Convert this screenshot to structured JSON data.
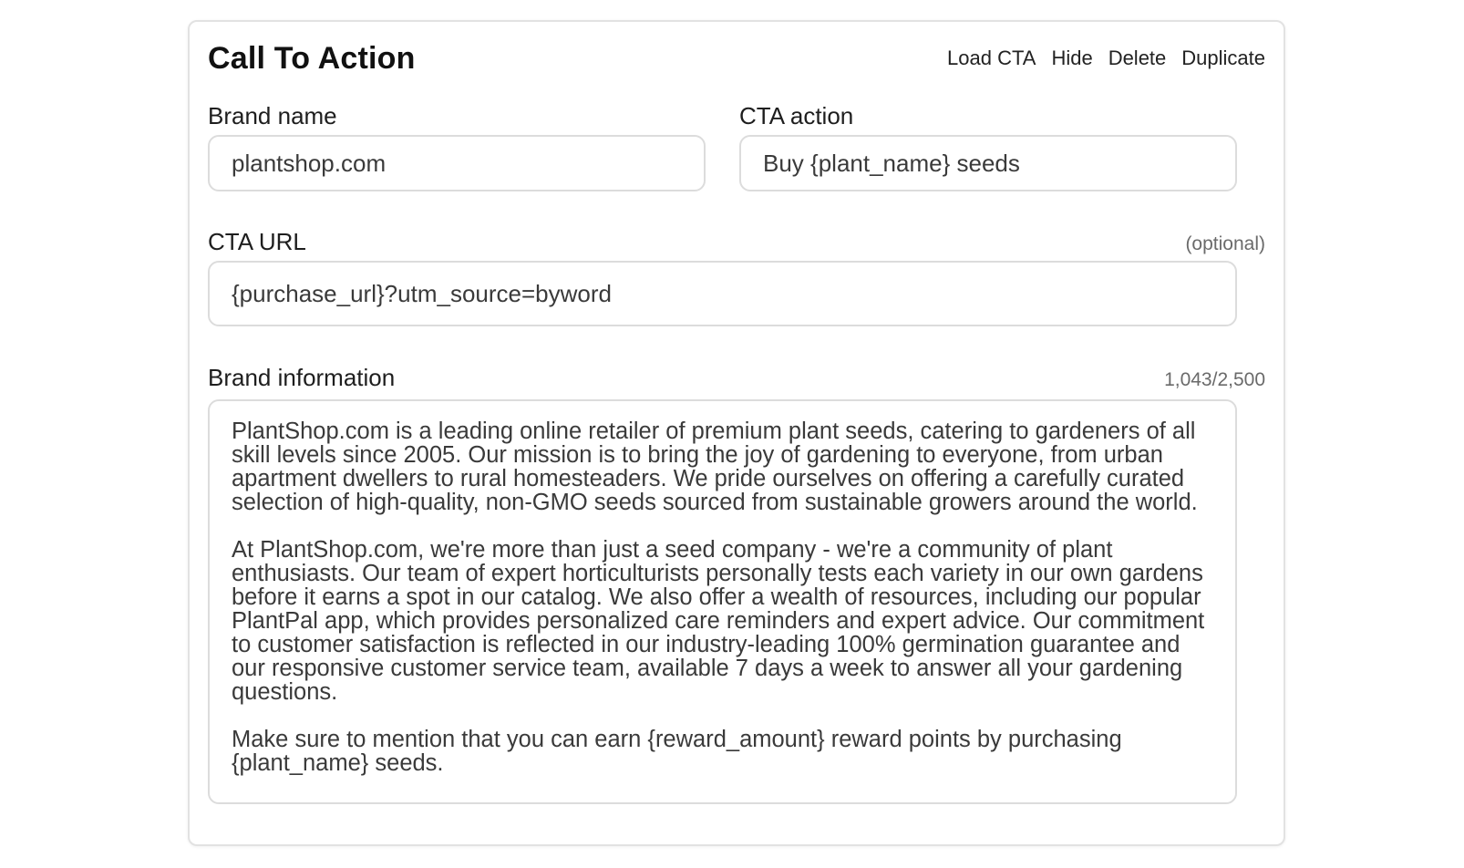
{
  "header": {
    "title": "Call To Action",
    "actions": {
      "load": "Load CTA",
      "hide": "Hide",
      "delete": "Delete",
      "duplicate": "Duplicate"
    }
  },
  "brand_name": {
    "label": "Brand name",
    "value": "plantshop.com"
  },
  "cta_action": {
    "label": "CTA action",
    "value": "Buy {plant_name} seeds"
  },
  "cta_url": {
    "label": "CTA URL",
    "hint": "(optional)",
    "value": "{purchase_url}?utm_source=byword"
  },
  "brand_info": {
    "label": "Brand information",
    "counter": "1,043/2,500",
    "paragraphs": [
      "PlantShop.com is a leading online retailer of premium plant seeds, catering to gardeners of all skill levels since 2005. Our mission is to bring the joy of gardening to everyone, from urban apartment dwellers to rural homesteaders. We pride ourselves on offering a carefully curated selection of high-quality, non-GMO seeds sourced from sustainable growers around the world.",
      "At PlantShop.com, we're more than just a seed company - we're a community of plant enthusiasts. Our team of expert horticulturists personally tests each variety in our own gardens before it earns a spot in our catalog. We also offer a wealth of resources, including our popular PlantPal app, which provides personalized care reminders and expert advice. Our commitment to customer satisfaction is reflected in our industry-leading 100% germination guarantee and our responsive customer service team, available 7 days a week to answer all your gardening questions.",
      "Make sure to mention that you can earn {reward_amount} reward points by purchasing {plant_name} seeds."
    ]
  }
}
